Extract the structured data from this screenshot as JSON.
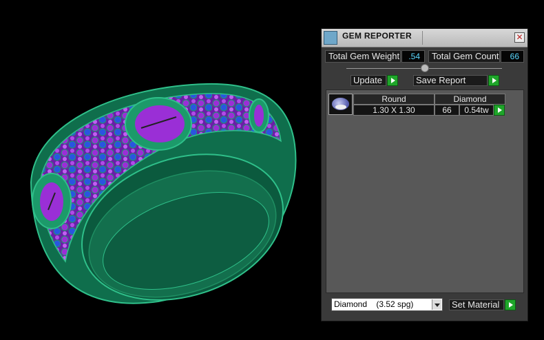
{
  "viewport": {
    "model": "ring-3d-model"
  },
  "panel": {
    "title": "GEM REPORTER",
    "close_glyph": "✕",
    "total_weight_label": "Total Gem Weight",
    "total_weight_value": ".54",
    "total_count_label": "Total Gem Count",
    "total_count_value": "66",
    "update_label": "Update",
    "save_report_label": "Save Report",
    "table": {
      "headers": [
        "Round",
        "Diamond"
      ],
      "row": {
        "size": "1.30 X 1.30",
        "count": "66",
        "weight": "0.54tw"
      }
    },
    "material_select": {
      "name": "Diamond",
      "spg": "(3.52 spg)"
    },
    "set_material_label": "Set Material"
  },
  "colors": {
    "ring_green": "#1c9a6a",
    "gem_purple": "#9a2fd6",
    "gem_blue": "#2a55e0",
    "accent_green": "#1fa52a",
    "value_cyan": "#5ad8ff"
  }
}
